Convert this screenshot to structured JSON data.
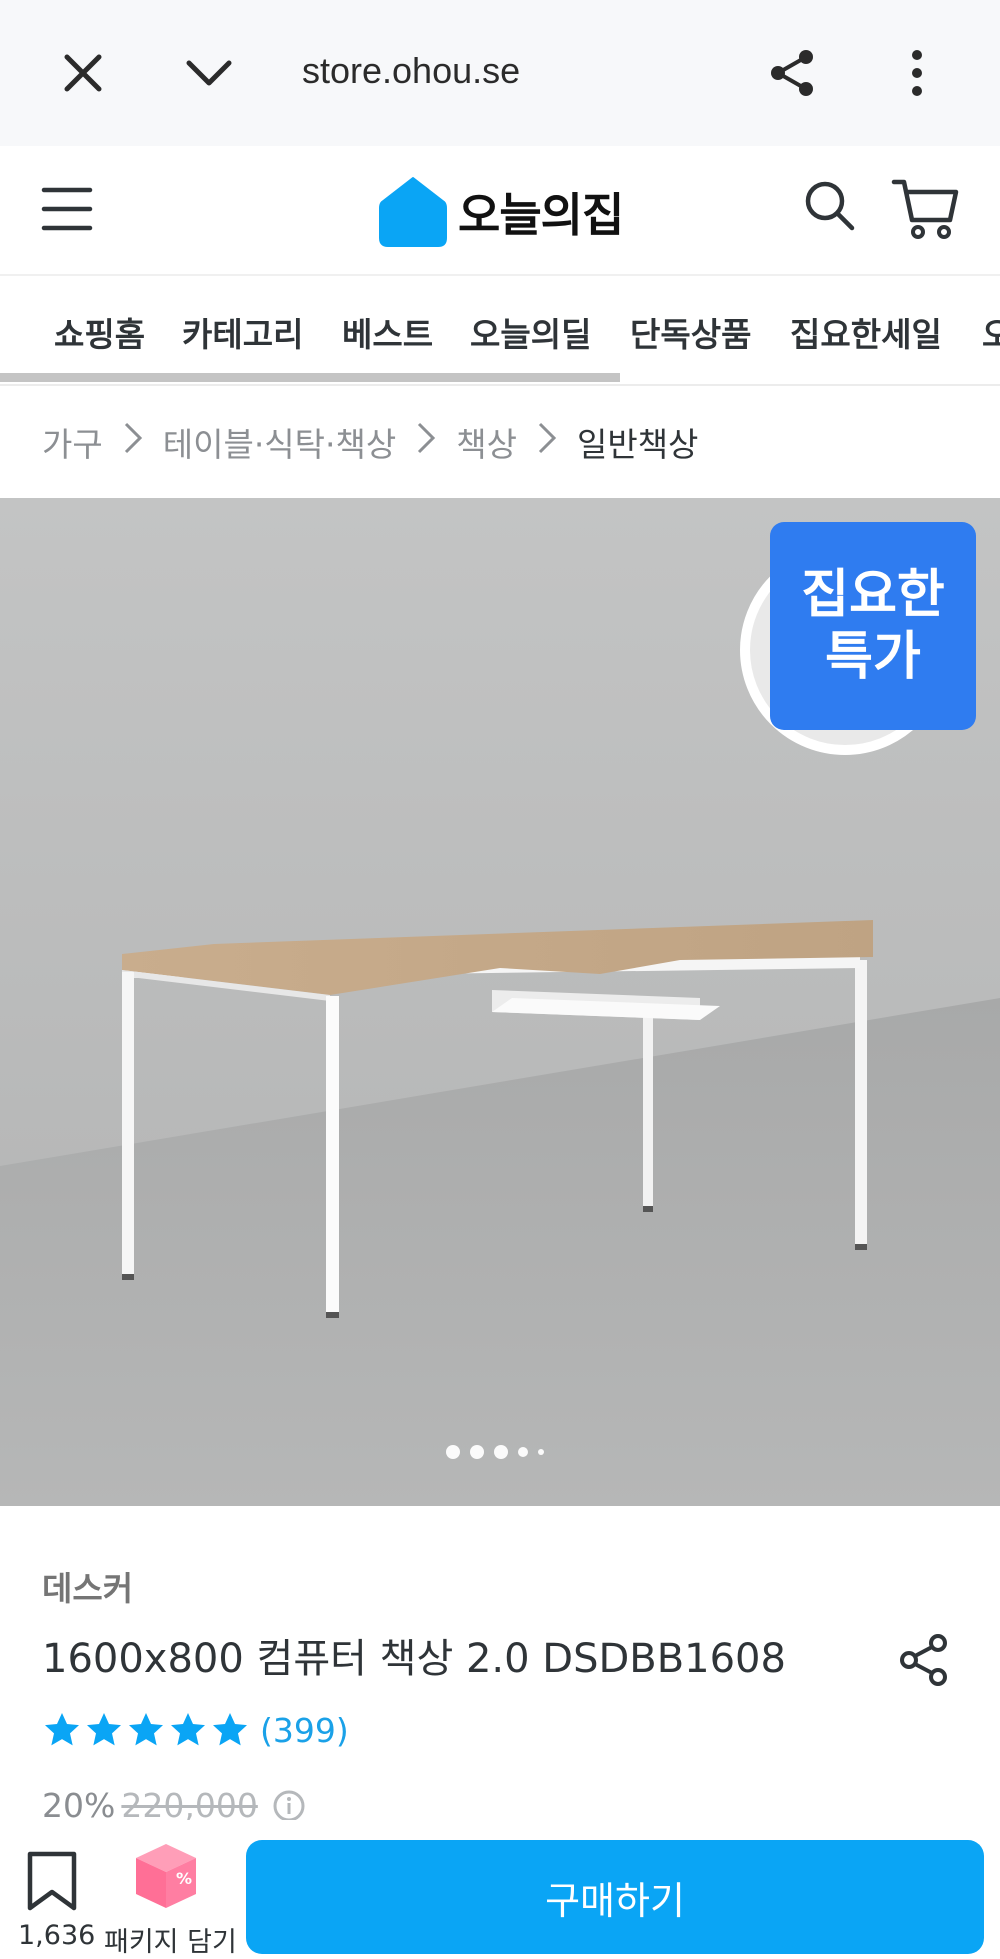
{
  "browser": {
    "url": "store.ohou.se",
    "icons": [
      "close-icon",
      "chevron-down-icon",
      "share-icon",
      "more-vertical-icon"
    ]
  },
  "header": {
    "logo_text": "오늘의집",
    "brand_color": "#35c5f0",
    "icons": [
      "menu-icon",
      "search-icon",
      "cart-icon"
    ]
  },
  "nav": {
    "tabs": [
      "쇼핑홈",
      "카테고리",
      "베스트",
      "오늘의딜",
      "단독상품",
      "집요한세일",
      "오"
    ],
    "scroll_progress": 0.62
  },
  "breadcrumb": {
    "items": [
      "가구",
      "테이블·식탁·책상",
      "책상",
      "일반책상"
    ]
  },
  "hero": {
    "badge_line1": "집요한",
    "badge_line2": "특가",
    "badge_color": "#2f7cf0",
    "image_count_dots": 5,
    "active_index": 0
  },
  "product": {
    "brand": "데스커",
    "title": "1600x800 컴퓨터 책상 2.0 DSDBB1608",
    "rating": 5,
    "review_count": "(399)",
    "discount": "20%",
    "original_price": "220,000"
  },
  "bottom": {
    "bookmark_count": "1,636",
    "package_label": "패키지 담기",
    "buy_label": "구매하기",
    "buy_color": "#0aa5f5"
  }
}
